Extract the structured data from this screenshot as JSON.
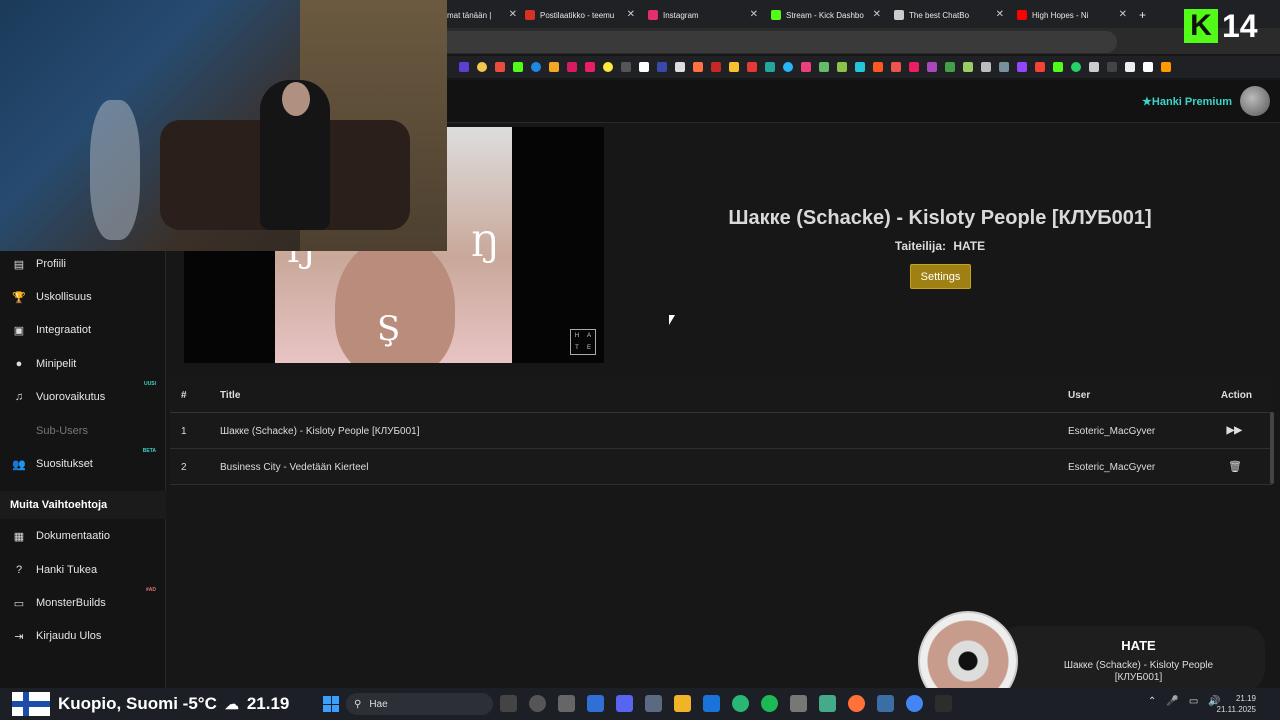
{
  "browser": {
    "tabs": [
      {
        "label": "mat tänään |",
        "color": "#555"
      },
      {
        "label": "Postilaatikko - teemu",
        "color": "#d93025"
      },
      {
        "label": "Instagram",
        "color": "#e1306c"
      },
      {
        "label": "Stream - Kick Dashbo",
        "color": "#53fc18"
      },
      {
        "label": "The best ChatBo",
        "color": "#cccccc"
      },
      {
        "label": "High Hopes - Ni",
        "color": "#ff0000"
      }
    ],
    "new_tab": "+",
    "tab_close": "✕"
  },
  "overlay": {
    "kick_count": "14",
    "kick_letter": "K"
  },
  "header": {
    "premium_label": "★Hanki Premium"
  },
  "sidebar": {
    "items": [
      {
        "label": "Profiili",
        "icon": "▤"
      },
      {
        "label": "Uskollisuus",
        "icon": "🏆"
      },
      {
        "label": "Integraatiot",
        "icon": "▣"
      },
      {
        "label": "Minipelit",
        "icon": "●"
      },
      {
        "label": "Vuorovaikutus",
        "icon": "♫",
        "badge": "UUSI"
      },
      {
        "label": "Sub-Users",
        "icon": "",
        "disabled": true
      },
      {
        "label": "Suositukset",
        "icon": "👥",
        "badge": "BETA"
      }
    ],
    "section_title": "Muita Vaihtoehtoja",
    "other_items": [
      {
        "label": "Dokumentaatio",
        "icon": "▦"
      },
      {
        "label": "Hanki Tukea",
        "icon": "?"
      },
      {
        "label": "MonsterBuilds",
        "icon": "▭",
        "badge": "#AD"
      },
      {
        "label": "Kirjaudu Ulos",
        "icon": "⇥"
      }
    ]
  },
  "track": {
    "title": "Шакке (Schacke) - Kisloty People [КЛУБ001]",
    "artist_label": "Taiteilija:",
    "artist": "HATE",
    "settings_label": "Settings",
    "art_glyphs": [
      "Ŋ",
      "Ŋ",
      "Ş"
    ],
    "art_box": [
      "H",
      "A",
      "T",
      "E"
    ]
  },
  "queue": {
    "columns": [
      "#",
      "Title",
      "User",
      "Action"
    ],
    "rows": [
      {
        "num": "1",
        "title": "Шакке (Schacke) - Kisloty People [КЛУБ001]",
        "user": "Esoteric_MacGyver",
        "action_icon": "▶▶"
      },
      {
        "num": "2",
        "title": "Business City - Vedetään Kierteel",
        "user": "Esoteric_MacGyver",
        "action_icon": "🗑"
      }
    ]
  },
  "now_playing": {
    "artist": "HATE",
    "title": "Шакке (Schacke) - Kisloty People [КЛУБ001]"
  },
  "taskbar": {
    "weather": "Kuopio, Suomi -5°C",
    "time_big": "21.19",
    "search_placeholder": "Hae",
    "clock_time": "21.19",
    "clock_date": "21.11.2025"
  }
}
